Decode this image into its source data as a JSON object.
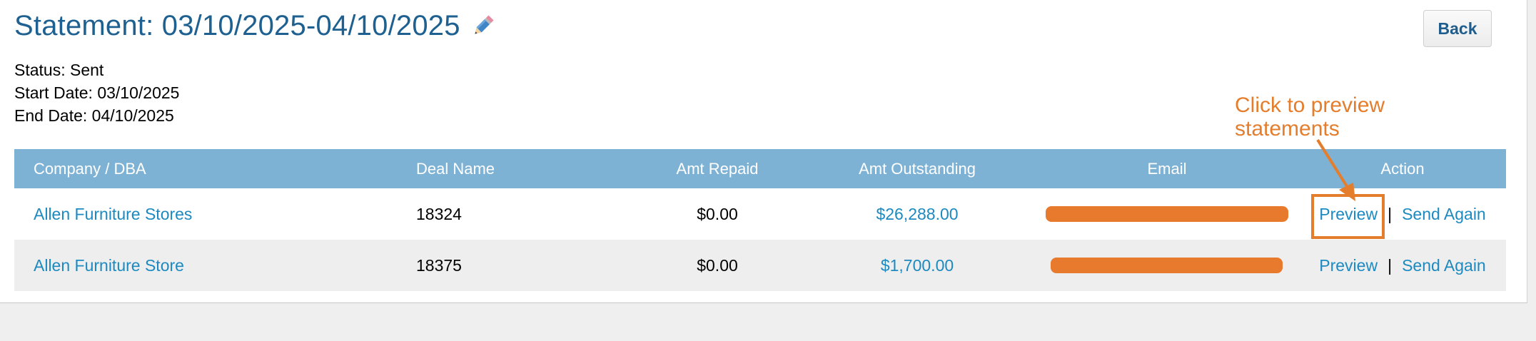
{
  "header": {
    "title": "Statement: 03/10/2025-04/10/2025",
    "edit_icon": "pencil-icon",
    "back_label": "Back"
  },
  "meta": {
    "status": "Status: Sent",
    "start_date": "Start Date: 03/10/2025",
    "end_date": "End Date: 04/10/2025"
  },
  "table": {
    "columns": [
      "Company / DBA",
      "Deal Name",
      "Amt Repaid",
      "Amt Outstanding",
      "Email",
      "Action"
    ],
    "rows": [
      {
        "company": "Allen Furniture Stores",
        "deal": "18324",
        "repaid": "$0.00",
        "outstanding": "$26,288.00",
        "preview": "Preview",
        "separator": "|",
        "send_again": "Send Again"
      },
      {
        "company": "Allen Furniture Store",
        "deal": "18375",
        "repaid": "$0.00",
        "outstanding": "$1,700.00",
        "preview": "Preview",
        "separator": "|",
        "send_again": "Send Again"
      }
    ]
  },
  "annotation": {
    "text_line1": "Click to preview",
    "text_line2": "statements",
    "color": "#e47d2c"
  },
  "colors": {
    "title": "#1e6191",
    "header_bg": "#7db2d5",
    "link": "#1c8ac0",
    "redaction": "#e87a2d"
  }
}
